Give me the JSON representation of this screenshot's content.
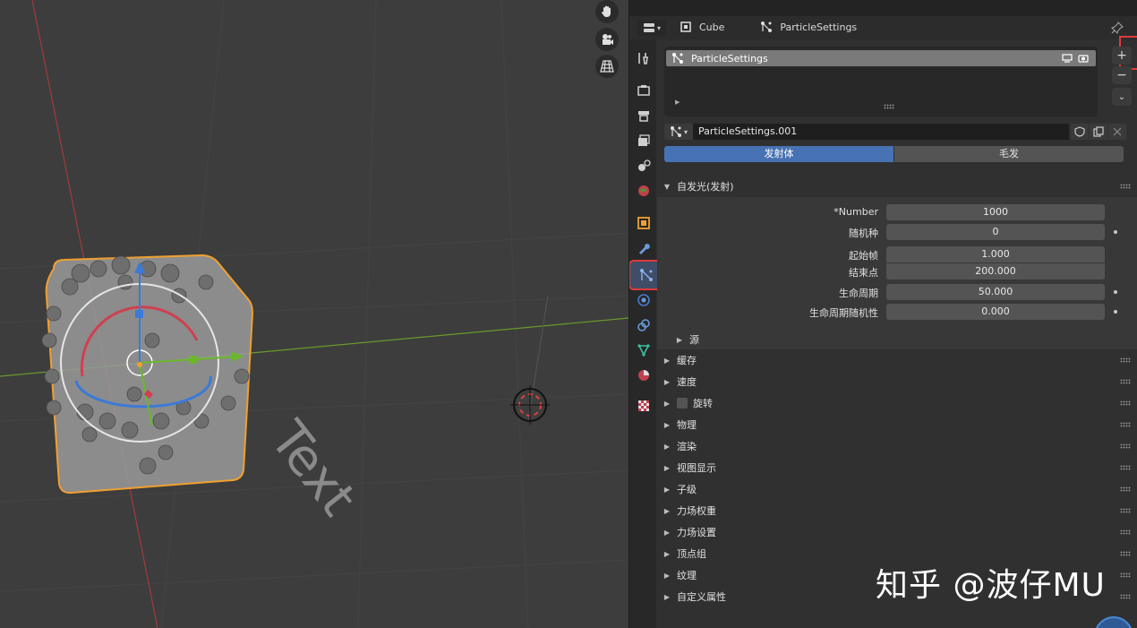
{
  "viewport": {
    "object_text": "Text",
    "nav_buttons": [
      "hand-icon",
      "camera-icon",
      "grid-icon"
    ]
  },
  "header": {
    "object_name": "Cube",
    "particle_name": "ParticleSettings"
  },
  "particle_slots": {
    "items": [
      {
        "label": "ParticleSettings"
      }
    ],
    "add_label": "+",
    "remove_label": "−"
  },
  "datablock": {
    "name": "ParticleSettings.001"
  },
  "type_toggle": {
    "emitter": "发射体",
    "hair": "毛发"
  },
  "emission_panel": {
    "title": "自发光(发射)",
    "fields": [
      {
        "label": "*Number",
        "value": "1000"
      },
      {
        "label": "随机种",
        "value": "0"
      },
      {
        "label": "起始帧",
        "value": "1.000"
      },
      {
        "label": "结束点",
        "value": "200.000"
      },
      {
        "label": "生命周期",
        "value": "50.000"
      },
      {
        "label": "生命周期随机性",
        "value": "0.000"
      }
    ],
    "subpanel": "源"
  },
  "panels": [
    {
      "label": "缓存"
    },
    {
      "label": "速度"
    },
    {
      "label": "旋转"
    },
    {
      "label": "物理"
    },
    {
      "label": "渲染"
    },
    {
      "label": "视图显示"
    },
    {
      "label": "子级"
    },
    {
      "label": "力场权重"
    },
    {
      "label": "力场设置"
    },
    {
      "label": "顶点组"
    },
    {
      "label": "纹理"
    },
    {
      "label": "自定义属性"
    }
  ],
  "watermark": "知乎 @波仔MU",
  "colors": {
    "accent": "#4772b3",
    "highlight": "#e03a3a",
    "selection_outline": "#f0a030"
  }
}
